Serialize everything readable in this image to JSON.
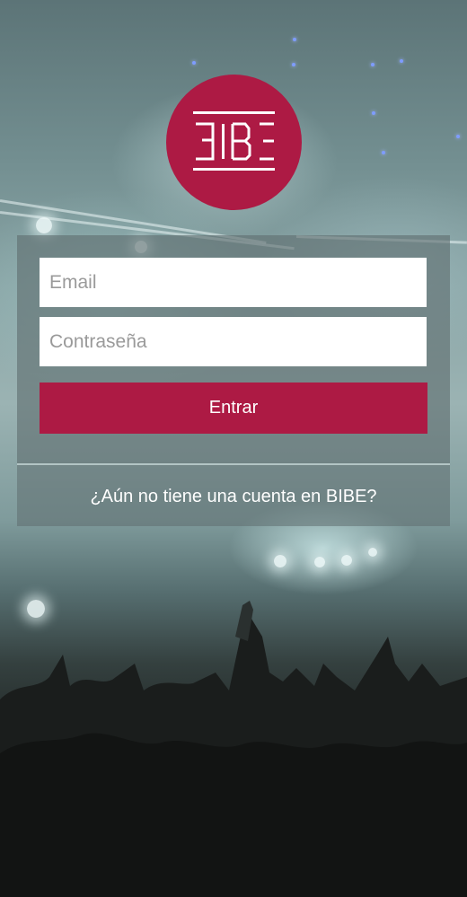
{
  "app": {
    "logo_text": "BIBE"
  },
  "login_form": {
    "email_placeholder": "Email",
    "password_placeholder": "Contraseña",
    "submit_label": "Entrar"
  },
  "signup": {
    "link_text": "¿Aún no tiene una cuenta en BIBE?"
  },
  "colors": {
    "brand": "#ad1a44",
    "panel_overlay": "#5f6e70",
    "field_background": "#ffffff",
    "text_on_brand": "#ffffff"
  },
  "icons": {
    "logo": "bibe-logo-icon"
  }
}
